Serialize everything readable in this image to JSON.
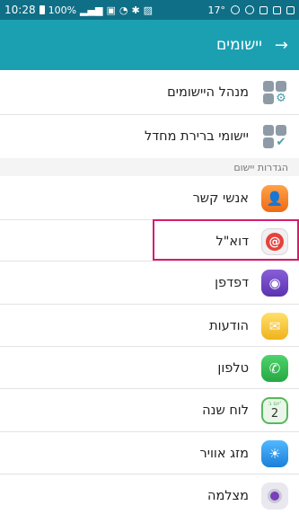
{
  "status": {
    "time": "10:28",
    "battery": "100%",
    "temp": "17°"
  },
  "header": {
    "title": "יישומים",
    "back_icon": "arrow-back-icon"
  },
  "top_items": [
    {
      "label": "מנהל היישומים",
      "icon": "apps-manager-icon"
    },
    {
      "label": "יישומי ברירת מחדל",
      "icon": "default-apps-icon"
    }
  ],
  "section": {
    "title": "הגדרות יישום"
  },
  "apps": [
    {
      "label": "אנשי קשר",
      "icon": "contacts-icon"
    },
    {
      "label": "דוא\"ל",
      "icon": "email-icon"
    },
    {
      "label": "דפדפן",
      "icon": "browser-icon"
    },
    {
      "label": "הודעות",
      "icon": "messages-icon"
    },
    {
      "label": "טלפון",
      "icon": "phone-icon"
    },
    {
      "label": "לוח שנה",
      "icon": "calendar-icon"
    },
    {
      "label": "מזג אוויר",
      "icon": "weather-icon"
    },
    {
      "label": "מצלמה",
      "icon": "camera-icon"
    }
  ],
  "calendar_icon": {
    "day": "2",
    "weekday": "יום ב'"
  },
  "colors": {
    "statusbar": "#0f6f86",
    "appbar": "#1ba0b2",
    "highlight": "#d81b6e"
  }
}
